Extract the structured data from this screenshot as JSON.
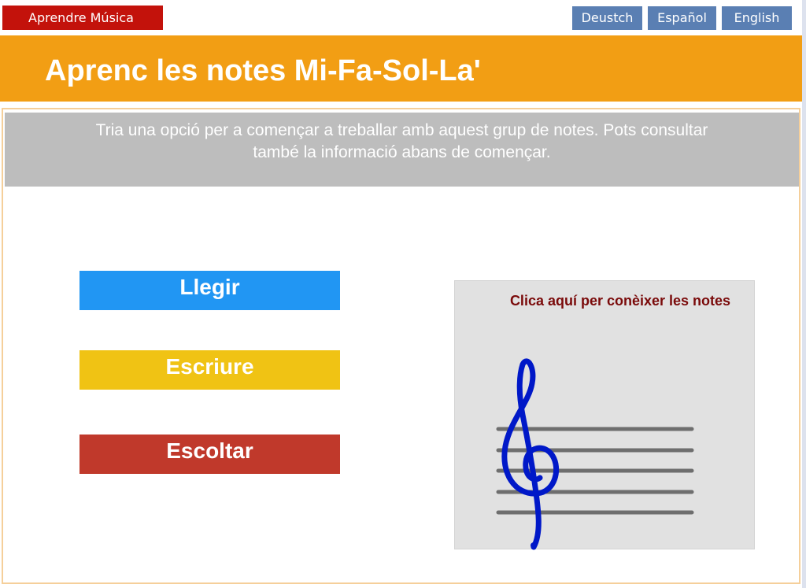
{
  "header": {
    "app_name": "Aprendre Música",
    "languages": [
      "Deustch",
      "Español",
      "English"
    ]
  },
  "title": "Aprenc les notes Mi-Fa-Sol-La'",
  "info_banner": {
    "line1": "Tria una opció per a començar a treballar amb aquest grup de notes. Pots consultar",
    "line2": "també la informació abans de començar."
  },
  "modes": {
    "read": "Llegir",
    "write": "Escriure",
    "listen": "Escoltar"
  },
  "notes_card": {
    "label": "Clica aquí per conèixer les notes",
    "icon": "treble-clef-staff-icon"
  },
  "colors": {
    "app_button": "#c3120b",
    "language_button": "#5a7fb3",
    "title_bar": "#f29e14",
    "info_banner": "#bdbdbd",
    "read_button": "#2196f3",
    "write_button": "#f0c314",
    "listen_button": "#c0392b",
    "card_title": "#7a0a0a",
    "clef": "#0018c8"
  }
}
